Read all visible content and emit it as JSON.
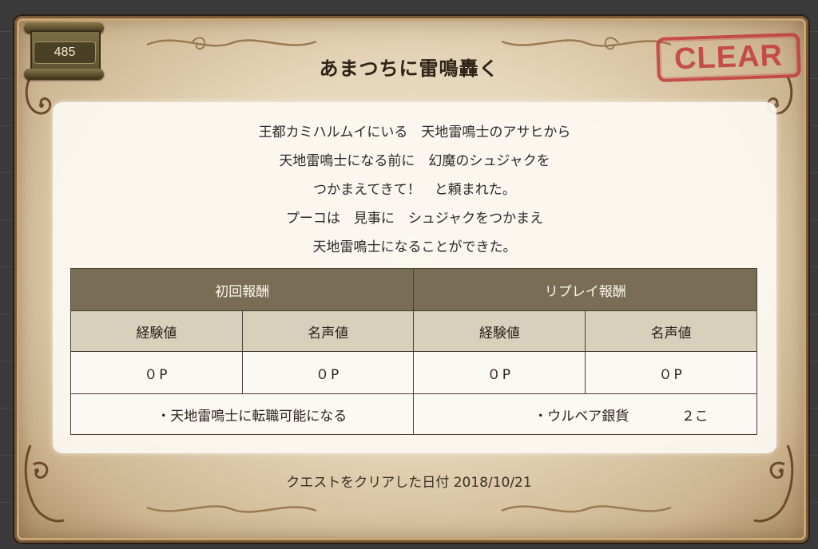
{
  "quest": {
    "number": "485",
    "title": "あまつちに雷鳴轟く",
    "status_stamp": "CLEAR",
    "description": [
      "王都カミハルムイにいる　天地雷鳴士のアサヒから",
      "天地雷鳴士になる前に　幻魔のシュジャクを",
      "つかまえてきて！　と頼まれた。",
      "プーコは　見事に　シュジャクをつかまえ",
      "天地雷鳴士になることができた。"
    ]
  },
  "rewards": {
    "first": {
      "header": "初回報酬",
      "exp_label": "経験値",
      "fame_label": "名声値",
      "exp_value": "０P",
      "fame_value": "０P",
      "item": "・天地雷鳴士に転職可能になる"
    },
    "replay": {
      "header": "リプレイ報酬",
      "exp_label": "経験値",
      "fame_label": "名声値",
      "exp_value": "０P",
      "fame_value": "０P",
      "item": "・ウルベア銀貨",
      "item_qty": "２こ"
    }
  },
  "footer": {
    "cleared_date": "クエストをクリアした日付 2018/10/21"
  },
  "colors": {
    "stamp": "#c23a3a",
    "table_header": "#7a6d56",
    "table_subheader": "#d8cfbd"
  }
}
